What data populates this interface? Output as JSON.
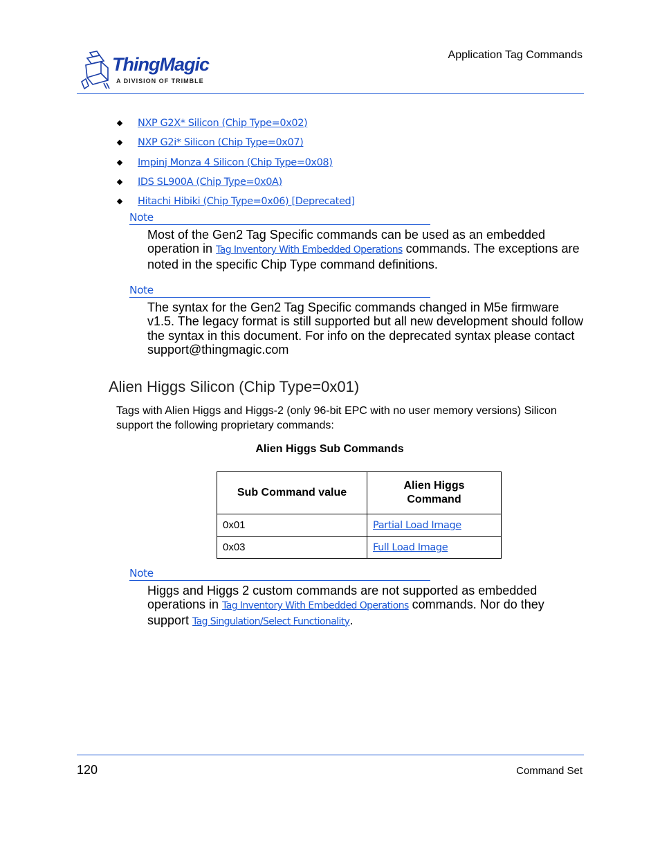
{
  "header": {
    "logo": {
      "name": "ThingMagic",
      "tagline": "A DIVISION OF TRIMBLE"
    },
    "section_title": "Application Tag Commands"
  },
  "chip_links": [
    "NXP G2X* Silicon (Chip Type=0x02)",
    "NXP G2i* Silicon (Chip Type=0x07)",
    "Impinj Monza 4 Silicon (Chip Type=0x08)",
    "IDS SL900A (Chip Type=0x0A)",
    "Hitachi Hibiki (Chip Type=0x06) [Deprecated]"
  ],
  "note1": {
    "label": "Note",
    "text_before": "Most of the Gen2 Tag Specific commands can be used as an embedded operation in ",
    "link": "Tag Inventory With Embedded Operations",
    "text_after": " commands. The exceptions are noted in the specific Chip Type command definitions."
  },
  "note2": {
    "label": "Note",
    "text": "The syntax for the Gen2 Tag Specific commands changed in M5e firmware v1.5. The legacy format is still supported but all new development should follow the syntax in this document. For info on the deprecated syntax please contact support@thingmagic.com"
  },
  "section": {
    "title": "Alien Higgs Silicon (Chip Type=0x01)",
    "intro": "Tags with Alien Higgs and Higgs-2 (only 96-bit EPC with no user memory versions) Silicon support the following proprietary commands:"
  },
  "table": {
    "caption": "Alien Higgs Sub Commands",
    "headers": [
      "Sub Command value",
      "Alien Higgs Command"
    ],
    "rows": [
      {
        "value": "0x01",
        "command": "Partial Load Image"
      },
      {
        "value": "0x03",
        "command": "Full Load Image"
      }
    ]
  },
  "note3": {
    "label": "Note",
    "text_before": "Higgs and Higgs 2 custom commands are not supported as embedded operations in ",
    "link1": "Tag Inventory With Embedded Operations",
    "text_middle": " commands. Nor do they support ",
    "link2": "Tag Singulation/Select Functionality",
    "text_after": "."
  },
  "footer": {
    "page_number": "120",
    "chapter": "Command Set"
  }
}
